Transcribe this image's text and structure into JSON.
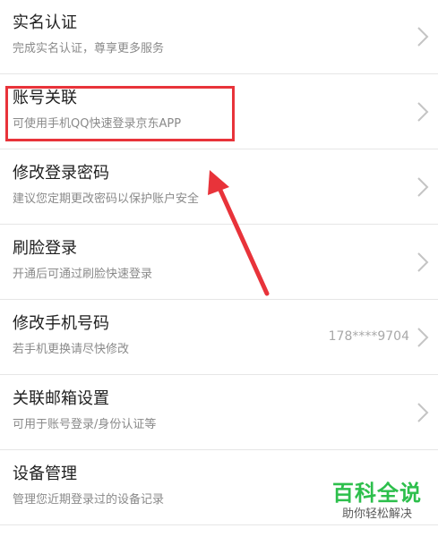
{
  "items": [
    {
      "title": "实名认证",
      "subtitle": "完成实名认证，尊享更多服务",
      "value": ""
    },
    {
      "title": "账号关联",
      "subtitle": "可使用手机QQ快速登录京东APP",
      "value": ""
    },
    {
      "title": "修改登录密码",
      "subtitle": "建议您定期更改密码以保护账户安全",
      "value": ""
    },
    {
      "title": "刷脸登录",
      "subtitle": "开通后可通过刷脸快速登录",
      "value": ""
    },
    {
      "title": "修改手机号码",
      "subtitle": "若手机更换请尽快修改",
      "value": "178****9704"
    },
    {
      "title": "关联邮箱设置",
      "subtitle": "可用于账号登录/身份认证等",
      "value": ""
    },
    {
      "title": "设备管理",
      "subtitle": "管理您近期登录过的设备记录",
      "value": ""
    }
  ],
  "watermark": {
    "main": "百科全说",
    "sub": "助你轻松解决"
  },
  "colors": {
    "highlight": "#e8333a",
    "watermark_green": "#2dbf4c"
  },
  "icons": {
    "row_chevron": "chevron-right-icon"
  }
}
